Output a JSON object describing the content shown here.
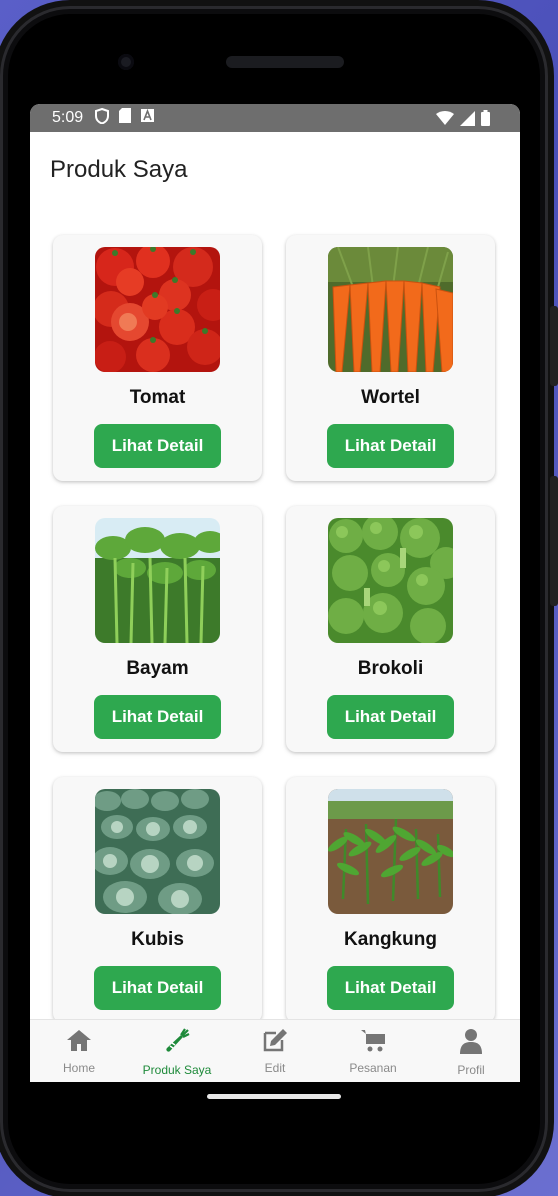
{
  "status_bar": {
    "time": "5:09",
    "icons": [
      "shield-icon",
      "sd-card-icon",
      "a-box-icon",
      "wifi-icon",
      "signal-icon",
      "battery-icon"
    ]
  },
  "header": {
    "title": "Produk Saya"
  },
  "products": [
    {
      "name": "Tomat",
      "button_label": "Lihat Detail",
      "image": "tomato-image"
    },
    {
      "name": "Wortel",
      "button_label": "Lihat Detail",
      "image": "carrot-image"
    },
    {
      "name": "Bayam",
      "button_label": "Lihat Detail",
      "image": "spinach-image"
    },
    {
      "name": "Brokoli",
      "button_label": "Lihat Detail",
      "image": "broccoli-image"
    },
    {
      "name": "Kubis",
      "button_label": "Lihat Detail",
      "image": "cabbage-image"
    },
    {
      "name": "Kangkung",
      "button_label": "Lihat Detail",
      "image": "water-spinach-image"
    }
  ],
  "bottom_nav": {
    "active": "Produk Saya",
    "items": [
      {
        "label": "Home",
        "icon": "home-icon"
      },
      {
        "label": "Produk Saya",
        "icon": "carrot-icon"
      },
      {
        "label": "Edit",
        "icon": "edit-icon"
      },
      {
        "label": "Pesanan",
        "icon": "cart-icon"
      },
      {
        "label": "Profil",
        "icon": "person-icon"
      }
    ]
  },
  "colors": {
    "accent": "#2ea84f",
    "active_nav": "#1e8a3a",
    "status_bar": "#6e6e6e"
  }
}
